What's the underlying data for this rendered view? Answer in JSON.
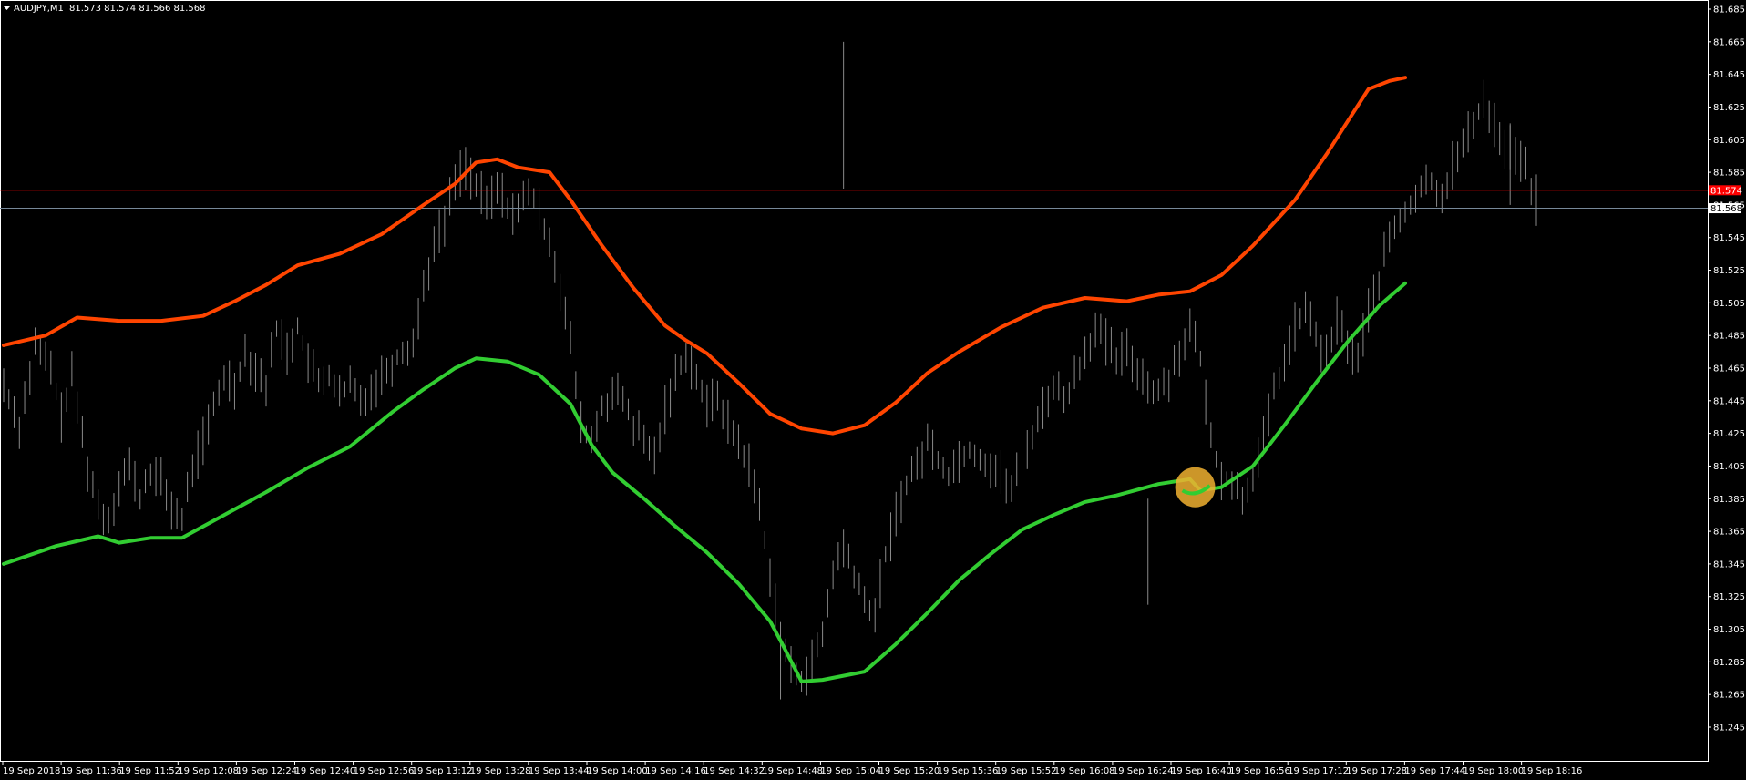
{
  "window": {
    "title": "AUDJPY,M1",
    "ohlc": "81.573 81.574 81.566 81.568",
    "menu_icon": "triangle-down-icon"
  },
  "colors": {
    "background": "#000000",
    "frame": "#ffffff",
    "bars": "#8a8a8a",
    "upper_band": "#ff4500",
    "lower_band": "#32cd32",
    "ask_line": "#ff0000",
    "bid_line": "#778899",
    "highlight": "#f0b030",
    "ask_label_bg": "#ff0000",
    "bid_label_bg": "#ffffff"
  },
  "price_labels": {
    "ask": "81.574",
    "bid": "81.568"
  },
  "chart_data": {
    "type": "line",
    "title": "AUDJPY,M1",
    "ylim": [
      81.235,
      81.695
    ],
    "y_ticks": [
      "81.685",
      "81.665",
      "81.645",
      "81.625",
      "81.605",
      "81.585",
      "81.565",
      "81.545",
      "81.525",
      "81.505",
      "81.485",
      "81.465",
      "81.445",
      "81.425",
      "81.405",
      "81.385",
      "81.365",
      "81.345",
      "81.325",
      "81.305",
      "81.285",
      "81.265",
      "81.245"
    ],
    "x_ticks": [
      "19 Sep 2018",
      "19 Sep 11:36",
      "19 Sep 11:52",
      "19 Sep 12:08",
      "19 Sep 12:24",
      "19 Sep 12:40",
      "19 Sep 12:56",
      "19 Sep 13:12",
      "19 Sep 13:28",
      "19 Sep 13:44",
      "19 Sep 14:00",
      "19 Sep 14:16",
      "19 Sep 14:32",
      "19 Sep 14:48",
      "19 Sep 15:04",
      "19 Sep 15:20",
      "19 Sep 15:36",
      "19 Sep 15:52",
      "19 Sep 16:08",
      "19 Sep 16:24",
      "19 Sep 16:40",
      "19 Sep 16:56",
      "19 Sep 17:12",
      "19 Sep 17:28",
      "19 Sep 17:44",
      "19 Sep 18:00",
      "19 Sep 18:16"
    ],
    "ask": 81.574,
    "bid": 81.568,
    "price_path": [
      [
        0,
        81.455
      ],
      [
        3,
        81.43
      ],
      [
        6,
        81.478
      ],
      [
        9,
        81.465
      ],
      [
        11,
        81.435
      ],
      [
        13,
        81.46
      ],
      [
        16,
        81.405
      ],
      [
        18,
        81.38
      ],
      [
        20,
        81.372
      ],
      [
        22,
        81.395
      ],
      [
        24,
        81.405
      ],
      [
        26,
        81.385
      ],
      [
        28,
        81.402
      ],
      [
        30,
        81.395
      ],
      [
        32,
        81.38
      ],
      [
        34,
        81.372
      ],
      [
        36,
        81.405
      ],
      [
        38,
        81.42
      ],
      [
        40,
        81.44
      ],
      [
        42,
        81.46
      ],
      [
        44,
        81.455
      ],
      [
        46,
        81.475
      ],
      [
        48,
        81.465
      ],
      [
        50,
        81.455
      ],
      [
        52,
        81.49
      ],
      [
        54,
        81.475
      ],
      [
        56,
        81.49
      ],
      [
        58,
        81.47
      ],
      [
        60,
        81.455
      ],
      [
        62,
        81.462
      ],
      [
        64,
        81.447
      ],
      [
        66,
        81.455
      ],
      [
        68,
        81.445
      ],
      [
        70,
        81.452
      ],
      [
        72,
        81.46
      ],
      [
        74,
        81.468
      ],
      [
        76,
        81.475
      ],
      [
        78,
        81.48
      ],
      [
        80,
        81.515
      ],
      [
        82,
        81.54
      ],
      [
        84,
        81.555
      ],
      [
        86,
        81.58
      ],
      [
        88,
        81.59
      ],
      [
        90,
        81.575
      ],
      [
        92,
        81.565
      ],
      [
        94,
        81.575
      ],
      [
        96,
        81.565
      ],
      [
        98,
        81.56
      ],
      [
        100,
        81.575
      ],
      [
        102,
        81.56
      ],
      [
        104,
        81.545
      ],
      [
        106,
        81.515
      ],
      [
        108,
        81.48
      ],
      [
        110,
        81.43
      ],
      [
        112,
        81.42
      ],
      [
        114,
        81.44
      ],
      [
        116,
        81.45
      ],
      [
        118,
        81.445
      ],
      [
        120,
        81.43
      ],
      [
        122,
        81.42
      ],
      [
        124,
        81.41
      ],
      [
        126,
        81.44
      ],
      [
        128,
        81.46
      ],
      [
        130,
        81.475
      ],
      [
        132,
        81.46
      ],
      [
        134,
        81.44
      ],
      [
        136,
        81.45
      ],
      [
        138,
        81.43
      ],
      [
        140,
        81.42
      ],
      [
        142,
        81.405
      ],
      [
        144,
        81.38
      ],
      [
        146,
        81.34
      ],
      [
        148,
        81.3
      ],
      [
        150,
        81.28
      ],
      [
        152,
        81.275
      ],
      [
        154,
        81.285
      ],
      [
        156,
        81.3
      ],
      [
        158,
        81.34
      ],
      [
        160,
        81.355
      ],
      [
        162,
        81.34
      ],
      [
        164,
        81.32
      ],
      [
        166,
        81.315
      ],
      [
        168,
        81.35
      ],
      [
        170,
        81.375
      ],
      [
        172,
        81.395
      ],
      [
        174,
        81.405
      ],
      [
        176,
        81.42
      ],
      [
        178,
        81.41
      ],
      [
        180,
        81.4
      ],
      [
        182,
        81.41
      ],
      [
        184,
        81.415
      ],
      [
        186,
        81.41
      ],
      [
        188,
        81.405
      ],
      [
        190,
        81.4
      ],
      [
        192,
        81.39
      ],
      [
        194,
        81.41
      ],
      [
        196,
        81.425
      ],
      [
        198,
        81.44
      ],
      [
        200,
        81.455
      ],
      [
        202,
        81.445
      ],
      [
        204,
        81.46
      ],
      [
        206,
        81.475
      ],
      [
        208,
        81.49
      ],
      [
        210,
        81.48
      ],
      [
        212,
        81.47
      ],
      [
        214,
        81.475
      ],
      [
        216,
        81.465
      ],
      [
        218,
        81.455
      ],
      [
        220,
        81.45
      ],
      [
        222,
        81.46
      ],
      [
        224,
        81.475
      ],
      [
        226,
        81.49
      ],
      [
        228,
        81.47
      ],
      [
        230,
        81.42
      ],
      [
        232,
        81.4
      ],
      [
        234,
        81.395
      ],
      [
        236,
        81.385
      ],
      [
        238,
        81.4
      ],
      [
        240,
        81.42
      ],
      [
        242,
        81.45
      ],
      [
        244,
        81.47
      ],
      [
        246,
        81.49
      ],
      [
        248,
        81.5
      ],
      [
        250,
        81.485
      ],
      [
        252,
        81.47
      ],
      [
        254,
        81.495
      ],
      [
        256,
        81.48
      ],
      [
        258,
        81.47
      ],
      [
        260,
        81.5
      ],
      [
        262,
        81.52
      ],
      [
        264,
        81.545
      ],
      [
        266,
        81.555
      ],
      [
        268,
        81.565
      ],
      [
        270,
        81.575
      ],
      [
        272,
        81.58
      ],
      [
        274,
        81.57
      ],
      [
        276,
        81.59
      ],
      [
        278,
        81.6
      ],
      [
        280,
        81.615
      ],
      [
        282,
        81.63
      ],
      [
        284,
        81.615
      ],
      [
        286,
        81.6
      ],
      [
        288,
        81.598
      ],
      [
        290,
        81.585
      ],
      [
        292,
        81.568
      ]
    ],
    "series": [
      {
        "name": "",
        "color": "#ff4500",
        "points": [
          [
            0,
            81.479
          ],
          [
            8,
            81.485
          ],
          [
            14,
            81.496
          ],
          [
            22,
            81.494
          ],
          [
            30,
            81.494
          ],
          [
            38,
            81.497
          ],
          [
            44,
            81.506
          ],
          [
            50,
            81.516
          ],
          [
            56,
            81.528
          ],
          [
            64,
            81.535
          ],
          [
            72,
            81.547
          ],
          [
            80,
            81.565
          ],
          [
            86,
            81.578
          ],
          [
            90,
            81.591
          ],
          [
            94,
            81.593
          ],
          [
            98,
            81.588
          ],
          [
            104,
            81.585
          ],
          [
            108,
            81.568
          ],
          [
            114,
            81.54
          ],
          [
            120,
            81.514
          ],
          [
            126,
            81.491
          ],
          [
            130,
            81.482
          ],
          [
            134,
            81.474
          ],
          [
            140,
            81.456
          ],
          [
            146,
            81.437
          ],
          [
            152,
            81.428
          ],
          [
            158,
            81.425
          ],
          [
            164,
            81.43
          ],
          [
            170,
            81.444
          ],
          [
            176,
            81.462
          ],
          [
            182,
            81.475
          ],
          [
            190,
            81.49
          ],
          [
            198,
            81.502
          ],
          [
            206,
            81.508
          ],
          [
            214,
            81.506
          ],
          [
            220,
            81.51
          ],
          [
            226,
            81.512
          ],
          [
            232,
            81.522
          ],
          [
            238,
            81.54
          ],
          [
            246,
            81.568
          ],
          [
            252,
            81.596
          ],
          [
            256,
            81.616
          ],
          [
            260,
            81.636
          ],
          [
            264,
            81.641
          ],
          [
            267,
            81.643
          ]
        ]
      },
      {
        "name": "",
        "color": "#32cd32",
        "points": [
          [
            0,
            81.345
          ],
          [
            10,
            81.356
          ],
          [
            18,
            81.362
          ],
          [
            22,
            81.358
          ],
          [
            28,
            81.361
          ],
          [
            34,
            81.361
          ],
          [
            42,
            81.375
          ],
          [
            50,
            81.389
          ],
          [
            58,
            81.404
          ],
          [
            66,
            81.417
          ],
          [
            74,
            81.438
          ],
          [
            80,
            81.452
          ],
          [
            86,
            81.465
          ],
          [
            90,
            81.471
          ],
          [
            96,
            81.469
          ],
          [
            102,
            81.461
          ],
          [
            108,
            81.443
          ],
          [
            112,
            81.418
          ],
          [
            116,
            81.401
          ],
          [
            122,
            81.385
          ],
          [
            128,
            81.368
          ],
          [
            134,
            81.352
          ],
          [
            140,
            81.333
          ],
          [
            146,
            81.31
          ],
          [
            148,
            81.298
          ],
          [
            152,
            81.273
          ],
          [
            156,
            81.274
          ],
          [
            164,
            81.279
          ],
          [
            170,
            81.296
          ],
          [
            176,
            81.315
          ],
          [
            182,
            81.335
          ],
          [
            188,
            81.351
          ],
          [
            194,
            81.366
          ],
          [
            200,
            81.375
          ],
          [
            206,
            81.383
          ],
          [
            212,
            81.387
          ],
          [
            220,
            81.394
          ],
          [
            226,
            81.397
          ],
          [
            228,
            81.39
          ],
          [
            232,
            81.392
          ],
          [
            238,
            81.405
          ],
          [
            244,
            81.43
          ],
          [
            250,
            81.456
          ],
          [
            256,
            81.481
          ],
          [
            262,
            81.503
          ],
          [
            267,
            81.517
          ]
        ]
      }
    ],
    "annotations": [
      {
        "type": "circle",
        "x": 227,
        "y": 81.392
      }
    ]
  }
}
